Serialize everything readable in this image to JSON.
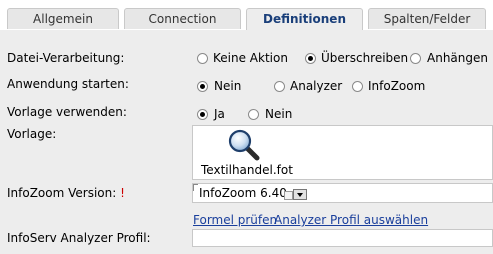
{
  "tabs": [
    {
      "label": "Allgemein",
      "active": false
    },
    {
      "label": "Connection",
      "active": false
    },
    {
      "label": "Definitionen",
      "active": true
    },
    {
      "label": "Spalten/Felder",
      "active": false
    }
  ],
  "form": {
    "datei_verarbeitung": {
      "label": "Datei-Verarbeitung:",
      "options": [
        "Keine Aktion",
        "Überschreiben",
        "Anhängen"
      ],
      "selected": "Überschreiben"
    },
    "anwendung_starten": {
      "label": "Anwendung starten:",
      "options": [
        "Nein",
        "Analyzer",
        "InfoZoom"
      ],
      "selected": "Nein"
    },
    "vorlage_verwenden": {
      "label": "Vorlage verwenden:",
      "options": [
        "Ja",
        "Nein"
      ],
      "selected": "Ja"
    },
    "vorlage": {
      "label": "Vorlage:",
      "file_name": "Textilhandel.fot",
      "icon": "magnifier-icon"
    },
    "infozoom_version": {
      "label": "InfoZoom Version:",
      "required_mark": "!",
      "value": "InfoZoom 6.40"
    },
    "links": {
      "formel_pruefen": "Formel prüfen",
      "analyzer_profil": "Analyzer Profil auswählen"
    },
    "infoserv_profil": {
      "label": "InfoServ Analyzer Profil:",
      "value": ""
    }
  },
  "colors": {
    "panel": "#ededed",
    "active_tab_text": "#1a3f7a",
    "link": "#1a3f9c",
    "required": "#cc0000"
  }
}
